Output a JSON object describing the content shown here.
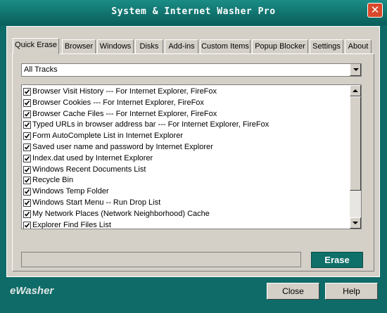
{
  "window": {
    "title": "System & Internet Washer Pro"
  },
  "tabs": [
    {
      "label": "Quick Erase",
      "active": true
    },
    {
      "label": "Browser"
    },
    {
      "label": "Windows"
    },
    {
      "label": "Disks"
    },
    {
      "label": "Add-ins"
    },
    {
      "label": "Custom Items"
    },
    {
      "label": "Popup Blocker"
    },
    {
      "label": "Settings"
    },
    {
      "label": "About"
    }
  ],
  "filter": {
    "selected": "All Tracks"
  },
  "items": [
    {
      "label": "Browser Visit History --- For Internet Explorer, FireFox",
      "checked": true
    },
    {
      "label": "Browser Cookies --- For Internet Explorer, FireFox",
      "checked": true
    },
    {
      "label": "Browser Cache Files --- For Internet Explorer, FireFox",
      "checked": true
    },
    {
      "label": "Typed URLs in browser address bar --- For Internet Explorer, FireFox",
      "checked": true
    },
    {
      "label": "Form AutoComplete List in Internet Explorer",
      "checked": true
    },
    {
      "label": "Saved user name and password by Internet Explorer",
      "checked": true
    },
    {
      "label": "Index.dat used by Internet Explorer",
      "checked": true
    },
    {
      "label": "Windows Recent Documents List",
      "checked": true
    },
    {
      "label": "Recycle Bin",
      "checked": true
    },
    {
      "label": "Windows Temp Folder",
      "checked": true
    },
    {
      "label": "Windows Start Menu -- Run Drop List",
      "checked": true
    },
    {
      "label": "My Network Places (Network Neighborhood) Cache",
      "checked": true
    },
    {
      "label": "Explorer Find Files List",
      "checked": true
    }
  ],
  "actions": {
    "erase": "Erase",
    "close": "Close",
    "help": "Help"
  },
  "brand": "eWasher",
  "colors": {
    "accent": "#0f6b66",
    "face": "#d4d0c8"
  }
}
